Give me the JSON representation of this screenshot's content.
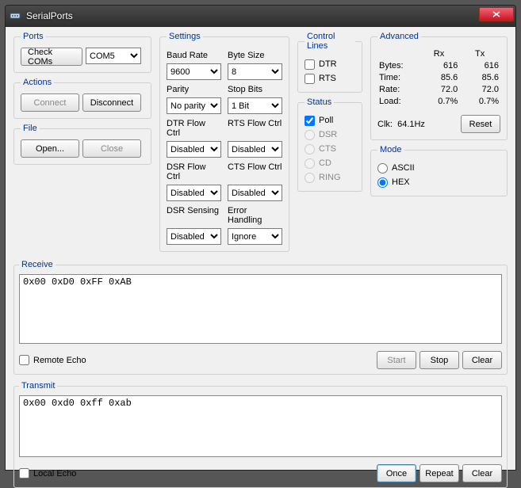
{
  "window": {
    "title": "SerialPorts"
  },
  "ports": {
    "legend": "Ports",
    "check_btn": "Check COMs",
    "com_value": "COM5"
  },
  "actions": {
    "legend": "Actions",
    "connect": "Connect",
    "disconnect": "Disconnect"
  },
  "file": {
    "legend": "File",
    "open": "Open...",
    "close": "Close"
  },
  "settings": {
    "legend": "Settings",
    "baud_label": "Baud Rate",
    "baud_value": "9600",
    "byte_label": "Byte Size",
    "byte_value": "8",
    "parity_label": "Parity",
    "parity_value": "No parity",
    "stopbits_label": "Stop Bits",
    "stopbits_value": "1 Bit",
    "dtrflow_label": "DTR Flow Ctrl",
    "dtrflow_value": "Disabled",
    "rtsflow_label": "RTS Flow Ctrl",
    "rtsflow_value": "Disabled",
    "dsrflow_label": "DSR Flow Ctrl",
    "dsrflow_value": "Disabled",
    "ctsflow_label": "CTS Flow Ctrl",
    "ctsflow_value": "Disabled",
    "dsrsense_label": "DSR Sensing",
    "dsrsense_value": "Disabled",
    "error_label": "Error Handling",
    "error_value": "Ignore"
  },
  "control_lines": {
    "legend": "Control Lines",
    "dtr": "DTR",
    "rts": "RTS"
  },
  "status": {
    "legend": "Status",
    "poll": "Poll",
    "dsr": "DSR",
    "cts": "CTS",
    "cd": "CD",
    "ring": "RING"
  },
  "advanced": {
    "legend": "Advanced",
    "rx": "Rx",
    "tx": "Tx",
    "bytes_lbl": "Bytes:",
    "bytes_rx": "616",
    "bytes_tx": "616",
    "time_lbl": "Time:",
    "time_rx": "85.6",
    "time_tx": "85.6",
    "rate_lbl": "Rate:",
    "rate_rx": "72.0",
    "rate_tx": "72.0",
    "load_lbl": "Load:",
    "load_rx": "0.7%",
    "load_tx": "0.7%",
    "clk_lbl": "Clk:",
    "clk_val": "64.1Hz",
    "reset": "Reset"
  },
  "mode": {
    "legend": "Mode",
    "ascii": "ASCII",
    "hex": "HEX"
  },
  "receive": {
    "legend": "Receive",
    "text": "0x00 0xD0 0xFF 0xAB",
    "remote_echo": "Remote Echo",
    "start": "Start",
    "stop": "Stop",
    "clear": "Clear"
  },
  "transmit": {
    "legend": "Transmit",
    "text": "0x00 0xd0 0xff 0xab",
    "local_echo": "Local Echo",
    "once": "Once",
    "repeat": "Repeat",
    "clear": "Clear"
  }
}
